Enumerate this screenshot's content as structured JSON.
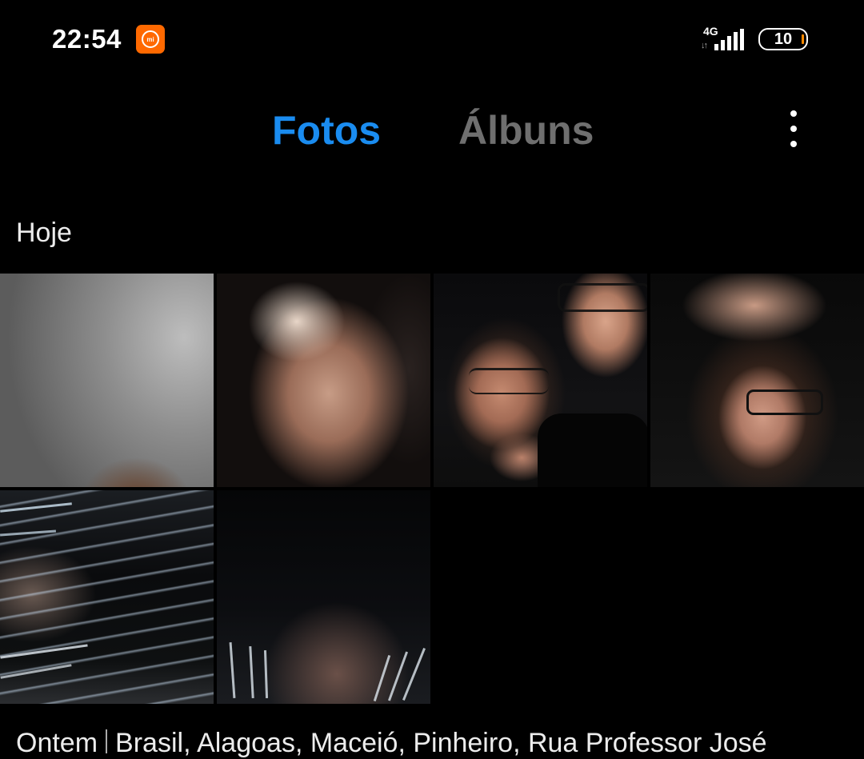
{
  "status_bar": {
    "time": "22:54",
    "notification_icon": "mi-icon",
    "network_type": "4G",
    "signal_icon": "signal-bars-icon",
    "battery_level": "10",
    "battery_accent_color": "#ff8a00"
  },
  "tabs": [
    {
      "label": "Fotos",
      "active": true,
      "color": "#1a8cf0"
    },
    {
      "label": "Álbuns",
      "active": false,
      "color": "#6f6f6f"
    }
  ],
  "menu_icon": "more-vertical-icon",
  "sections": [
    {
      "title": "Hoje",
      "photo_count": 6
    },
    {
      "title": "Ontem",
      "location": "Brasil, Alagoas, Maceió, Pinheiro, Rua Professor José"
    }
  ]
}
